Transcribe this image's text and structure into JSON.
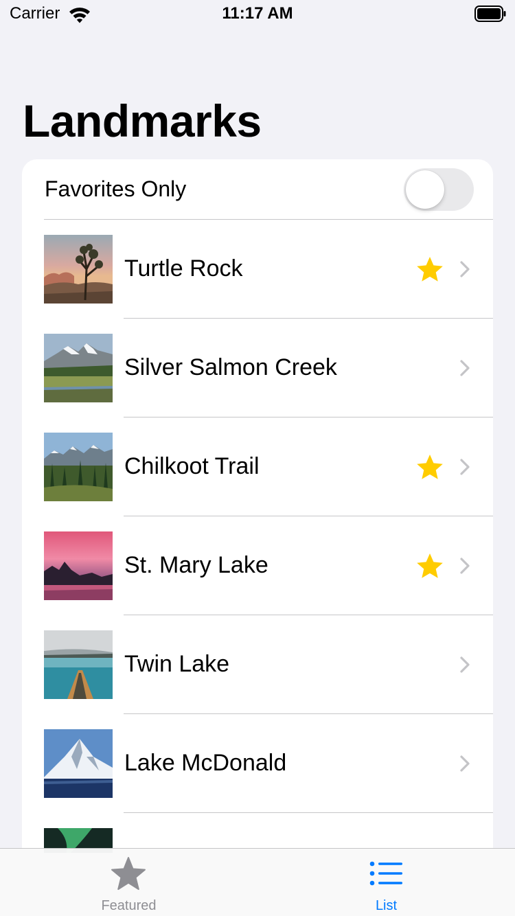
{
  "status_bar": {
    "carrier": "Carrier",
    "time": "11:17 AM"
  },
  "title": "Landmarks",
  "favorites_toggle": {
    "label": "Favorites Only",
    "on": false
  },
  "landmarks": [
    {
      "name": "Turtle Rock",
      "favorite": true,
      "thumb": "desert-joshua-tree"
    },
    {
      "name": "Silver Salmon Creek",
      "favorite": false,
      "thumb": "snowy-mountain-meadow"
    },
    {
      "name": "Chilkoot Trail",
      "favorite": true,
      "thumb": "mountain-forest"
    },
    {
      "name": "St. Mary Lake",
      "favorite": true,
      "thumb": "pink-sunset-lake"
    },
    {
      "name": "Twin Lake",
      "favorite": false,
      "thumb": "canoe-on-lake"
    },
    {
      "name": "Lake McDonald",
      "favorite": false,
      "thumb": "snow-peak-lake"
    },
    {
      "name": "",
      "favorite": false,
      "thumb": "aurora"
    }
  ],
  "tabs": [
    {
      "label": "Featured",
      "icon": "star-fill-icon",
      "selected": false
    },
    {
      "label": "List",
      "icon": "list-bullet-icon",
      "selected": true
    }
  ],
  "colors": {
    "accent": "#007aff",
    "star": "#ffcc00",
    "background": "#f2f2f7"
  }
}
